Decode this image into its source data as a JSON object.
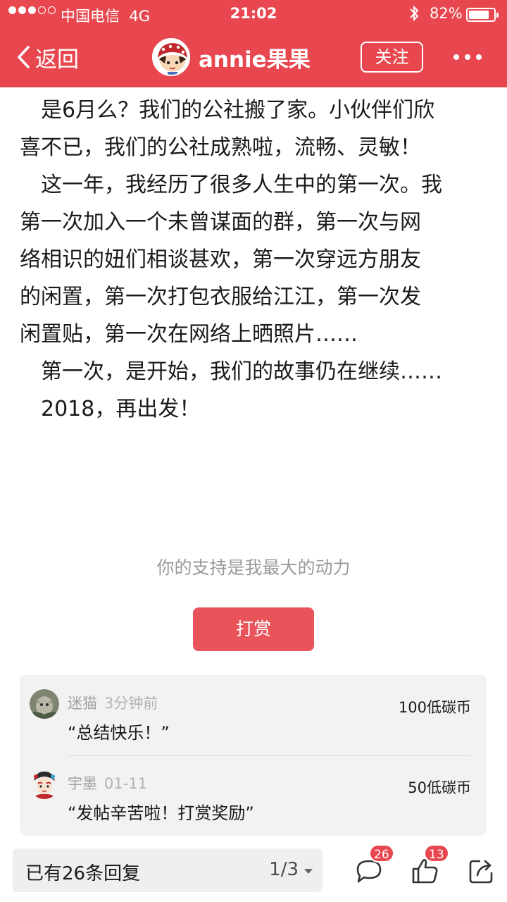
{
  "status_bar": {
    "carrier": "中国电信",
    "network": "4G",
    "time": "21:02",
    "battery": "82%"
  },
  "nav": {
    "back_label": "返回",
    "author_name": "annie果果",
    "follow_label": "关注"
  },
  "article": {
    "lines": [
      "是6月么？我们的公社搬了家。小伙伴们欣",
      "喜不已，我们的公社成熟啦，流畅、灵敏！",
      "这一年，我经历了很多人生中的第一次。我",
      "第一次加入一个未曾谋面的群，第一次与网",
      "络相识的妞们相谈甚欢，第一次穿远方朋友",
      "的闲置，第一次打包衣服给江江，第一次发",
      "闲置贴，第一次在网络上晒照片……",
      "第一次，是开始，我们的故事仍在继续……",
      "2018，再出发！"
    ]
  },
  "support": {
    "text": "你的支持是我最大的动力",
    "tip_label": "打赏"
  },
  "rewards": [
    {
      "user": "迷猫",
      "time": "3分钟前",
      "amount": "100低碳币",
      "message": "“总结快乐！”"
    },
    {
      "user": "宇墨",
      "time": "01-11",
      "amount": "50低碳币",
      "message": "“发帖辛苦啦！打赏奖励”"
    }
  ],
  "bottom": {
    "reply_text": "已有26条回复",
    "page": "1/3",
    "comment_count": "26",
    "like_count": "13"
  },
  "colors": {
    "brand_red": "#e8474f",
    "tip_button": "#e8545a",
    "panel_bg": "#f2f2f2"
  },
  "icons": [
    "back-chevron-icon",
    "more-dots-icon",
    "comment-icon",
    "thumbs-up-icon",
    "share-icon",
    "bluetooth-icon",
    "battery-icon"
  ]
}
